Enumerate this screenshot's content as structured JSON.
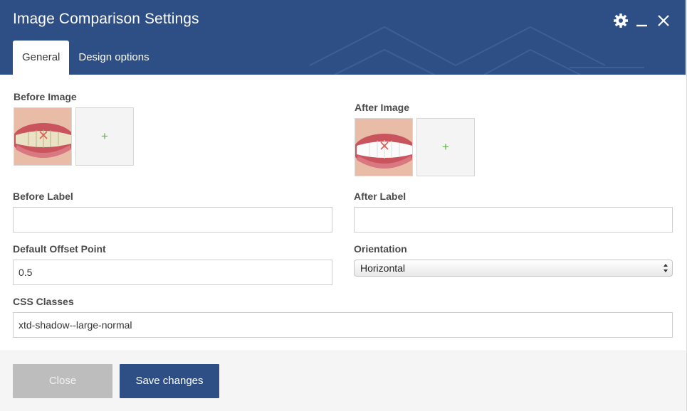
{
  "header": {
    "title": "Image Comparison Settings",
    "bg_color": "#2d4f86",
    "icons": [
      "gear-icon",
      "minimize-icon",
      "close-icon"
    ]
  },
  "tabs": [
    {
      "label": "General",
      "active": true
    },
    {
      "label": "Design options",
      "active": false
    }
  ],
  "form": {
    "before_image": {
      "label": "Before Image",
      "add_glyph": "+"
    },
    "after_image": {
      "label": "After Image",
      "add_glyph": "+"
    },
    "before_label": {
      "label": "Before Label",
      "value": ""
    },
    "after_label": {
      "label": "After Label",
      "value": ""
    },
    "offset": {
      "label": "Default Offset Point",
      "value": "0.5"
    },
    "orientation": {
      "label": "Orientation",
      "selected": "Horizontal"
    },
    "css_classes": {
      "label": "CSS Classes",
      "value": "xtd-shadow--large-normal"
    }
  },
  "footer": {
    "close_label": "Close",
    "save_label": "Save changes"
  },
  "colors": {
    "accent": "#2d4f86",
    "add_plus": "#6ab04c",
    "remove_x": "#e05a4f"
  }
}
